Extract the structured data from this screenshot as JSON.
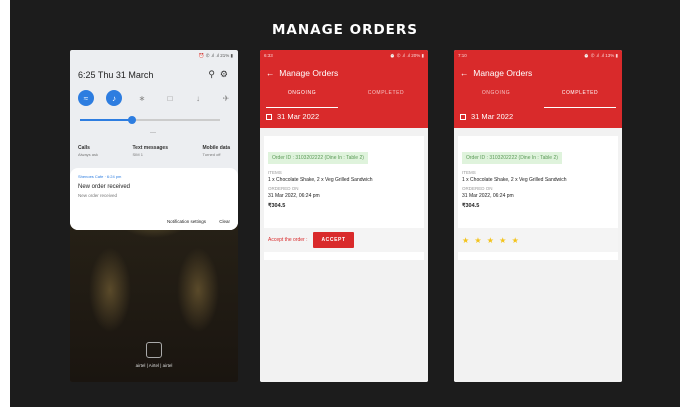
{
  "slide": {
    "title": "MANAGE ORDERS"
  },
  "phone1": {
    "status": "⏰ ✆ .ıl .ıl 21% ▮",
    "time_date": "6:25  Thu 31 March",
    "quick_settings": [
      "wifi-icon",
      "volume-icon",
      "bluetooth-icon",
      "rotate-icon",
      "flashlight-icon",
      "airplane-icon"
    ],
    "dots": "—",
    "columns": [
      {
        "title": "Calls",
        "sub": "Always ask"
      },
      {
        "title": "Text messages",
        "sub": "SIM 1"
      },
      {
        "title": "Mobile data",
        "sub": "Turned off"
      }
    ],
    "notification": {
      "app": "Shenoes Cafe · 6:24 pm",
      "title": "New order received",
      "body": "New order received",
      "actions": [
        "Notification settings",
        "Clear"
      ]
    },
    "carrier": "airtel | Airtel | airtel"
  },
  "phone2": {
    "status_left": "6:33",
    "status_right": "⏰ ✆ .ıl .ıl 20% ▮",
    "title": "Manage Orders",
    "tabs": [
      "ONGOING",
      "COMPLETED"
    ],
    "active_tab": 0,
    "date": "31 Mar 2022",
    "order": {
      "id": "Order ID : 3103202222 (Dine In : Table 2)",
      "items_label": "ITEMS",
      "items": "1 x Chocolate Shake, 2 x Veg Grilled Sandwich",
      "ordered_label": "ORDERED ON",
      "ordered_on": "31 Mar 2022, 06:24 pm",
      "price": "₹304.5"
    },
    "accept_label": "Accept the order :",
    "accept_button": "ACCEPT"
  },
  "phone3": {
    "status_left": "7:10",
    "status_right": "⏰ ✆ .ıl .ıl 13% ▮",
    "title": "Manage Orders",
    "tabs": [
      "ONGOING",
      "COMPLETED"
    ],
    "active_tab": 1,
    "date": "31 Mar 2022",
    "order": {
      "id": "Order ID : 3103202222 (Dine In : Table 2)",
      "items_label": "ITEMS",
      "items": "1 x Chocolate Shake, 2 x Veg Grilled Sandwich",
      "ordered_label": "ORDERED ON",
      "ordered_on": "31 Mar 2022, 06:24 pm",
      "price": "₹304.5"
    },
    "stars": "★ ★ ★ ★ ★"
  },
  "colors": {
    "accent": "#d92a2b",
    "blue": "#2d7de0",
    "star": "#f3c31a",
    "id_bg": "#dff3dc"
  }
}
